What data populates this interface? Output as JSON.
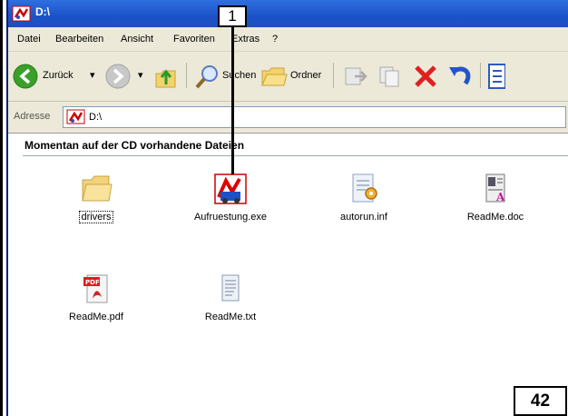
{
  "window": {
    "title": "D:\\"
  },
  "menu": [
    "Datei",
    "Bearbeiten",
    "Ansicht",
    "Favoriten",
    "Extras",
    "?"
  ],
  "toolbar": {
    "back_label": "Zurück",
    "search_label": "Suchen",
    "folders_label": "Ordner"
  },
  "address": {
    "label": "Adresse",
    "value": "D:\\"
  },
  "content": {
    "section_title": "Momentan auf der CD vorhandene Dateien",
    "files": [
      {
        "name": "drivers",
        "icon": "folder-icon"
      },
      {
        "name": "Aufruestung.exe",
        "icon": "upgrade-exe-icon"
      },
      {
        "name": "autorun.inf",
        "icon": "settings-file-icon"
      },
      {
        "name": "ReadMe.doc",
        "icon": "word-document-icon"
      },
      {
        "name": "ReadMe.pdf",
        "icon": "pdf-file-icon"
      },
      {
        "name": "ReadMe.txt",
        "icon": "text-file-icon"
      }
    ]
  },
  "callout": {
    "number": "1"
  },
  "page_number": "42",
  "colors": {
    "title_bar": "#1c52c8",
    "chrome": "#ece9d8",
    "back_green": "#3aa02a",
    "delete_red": "#e02020",
    "undo_blue": "#2255cc"
  }
}
